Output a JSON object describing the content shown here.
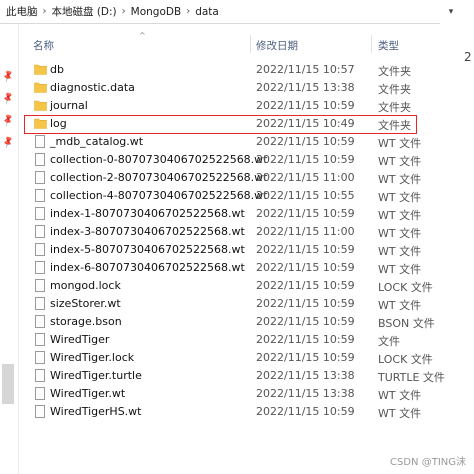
{
  "breadcrumb": [
    "此电脑",
    "本地磁盘 (D:)",
    "MongoDB",
    "data"
  ],
  "edge_text": "2",
  "columns": {
    "name": "名称",
    "date": "修改日期",
    "type": "类型"
  },
  "files": [
    {
      "name": "db",
      "date": "2022/11/15 10:57",
      "type": "文件夹",
      "kind": "folder"
    },
    {
      "name": "diagnostic.data",
      "date": "2022/11/15 13:38",
      "type": "文件夹",
      "kind": "folder"
    },
    {
      "name": "journal",
      "date": "2022/11/15 10:59",
      "type": "文件夹",
      "kind": "folder"
    },
    {
      "name": "log",
      "date": "2022/11/15 10:49",
      "type": "文件夹",
      "kind": "folder"
    },
    {
      "name": "_mdb_catalog.wt",
      "date": "2022/11/15 10:59",
      "type": "WT 文件",
      "kind": "file"
    },
    {
      "name": "collection-0-8070730406702522568.wt",
      "date": "2022/11/15 10:59",
      "type": "WT 文件",
      "kind": "file"
    },
    {
      "name": "collection-2-8070730406702522568.wt",
      "date": "2022/11/15 11:00",
      "type": "WT 文件",
      "kind": "file"
    },
    {
      "name": "collection-4-8070730406702522568.wt",
      "date": "2022/11/15 10:55",
      "type": "WT 文件",
      "kind": "file"
    },
    {
      "name": "index-1-8070730406702522568.wt",
      "date": "2022/11/15 10:59",
      "type": "WT 文件",
      "kind": "file"
    },
    {
      "name": "index-3-8070730406702522568.wt",
      "date": "2022/11/15 11:00",
      "type": "WT 文件",
      "kind": "file"
    },
    {
      "name": "index-5-8070730406702522568.wt",
      "date": "2022/11/15 10:59",
      "type": "WT 文件",
      "kind": "file"
    },
    {
      "name": "index-6-8070730406702522568.wt",
      "date": "2022/11/15 10:59",
      "type": "WT 文件",
      "kind": "file"
    },
    {
      "name": "mongod.lock",
      "date": "2022/11/15 10:59",
      "type": "LOCK 文件",
      "kind": "file"
    },
    {
      "name": "sizeStorer.wt",
      "date": "2022/11/15 10:59",
      "type": "WT 文件",
      "kind": "file"
    },
    {
      "name": "storage.bson",
      "date": "2022/11/15 10:59",
      "type": "BSON 文件",
      "kind": "file"
    },
    {
      "name": "WiredTiger",
      "date": "2022/11/15 10:59",
      "type": "文件",
      "kind": "file"
    },
    {
      "name": "WiredTiger.lock",
      "date": "2022/11/15 10:59",
      "type": "LOCK 文件",
      "kind": "file"
    },
    {
      "name": "WiredTiger.turtle",
      "date": "2022/11/15 13:38",
      "type": "TURTLE 文件",
      "kind": "file"
    },
    {
      "name": "WiredTiger.wt",
      "date": "2022/11/15 13:38",
      "type": "WT 文件",
      "kind": "file"
    },
    {
      "name": "WiredTigerHS.wt",
      "date": "2022/11/15 10:59",
      "type": "WT 文件",
      "kind": "file"
    }
  ],
  "highlighted_row": "log",
  "watermark": "CSDN @TING沫",
  "colors": {
    "folder": "#f4c548",
    "folder_tab": "#e2a92a",
    "highlight": "#e8262a",
    "header_text": "#4d6082"
  }
}
